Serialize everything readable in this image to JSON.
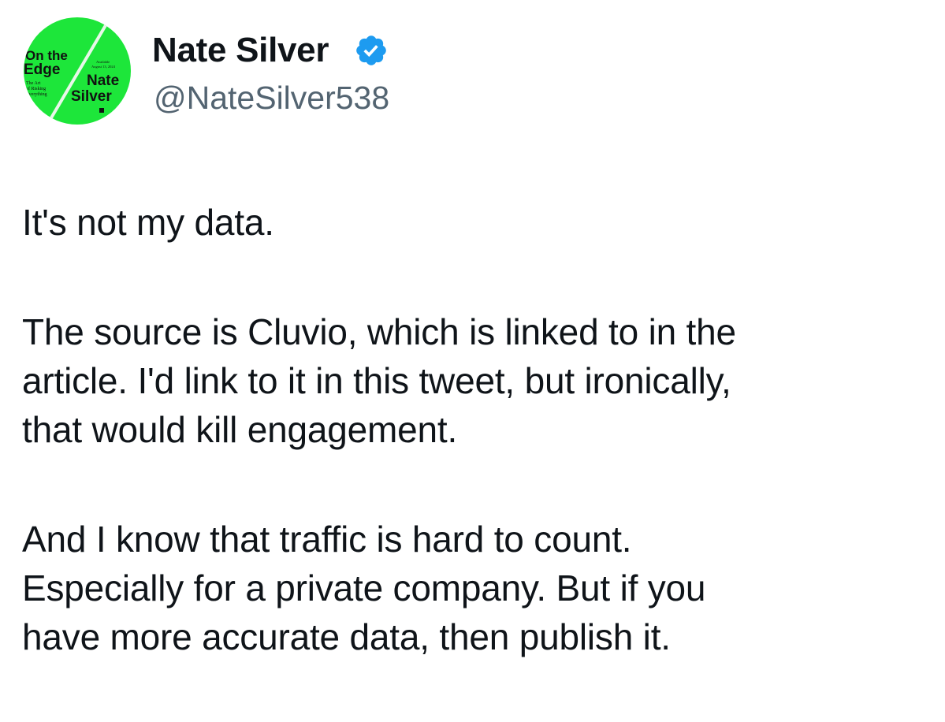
{
  "author": {
    "name": "Nate Silver",
    "handle": "@NateSilver538",
    "verified": true,
    "verified_color": "#1d9bf0",
    "avatar": {
      "description_icon": "book-cover-avatar-icon",
      "background_color": "#1de63a",
      "title_line1": "On the",
      "title_line2": "Edge",
      "subtitle_lines": [
        "The Art",
        "of Risking",
        "Everything"
      ],
      "available_lines": [
        "Available",
        "August 13, 2024"
      ],
      "author_line1": "Nate",
      "author_line2": "Silver"
    }
  },
  "tweet": {
    "paragraphs": [
      [
        "It's not my data."
      ],
      [
        "The source is Cluvio, which is linked to in the",
        "article. I'd link to it in this tweet, but ironically,",
        "that would kill engagement."
      ],
      [
        "And I know that traffic is hard to count.",
        "Especially for a private company. But if you",
        "have more accurate data, then publish it."
      ]
    ]
  }
}
